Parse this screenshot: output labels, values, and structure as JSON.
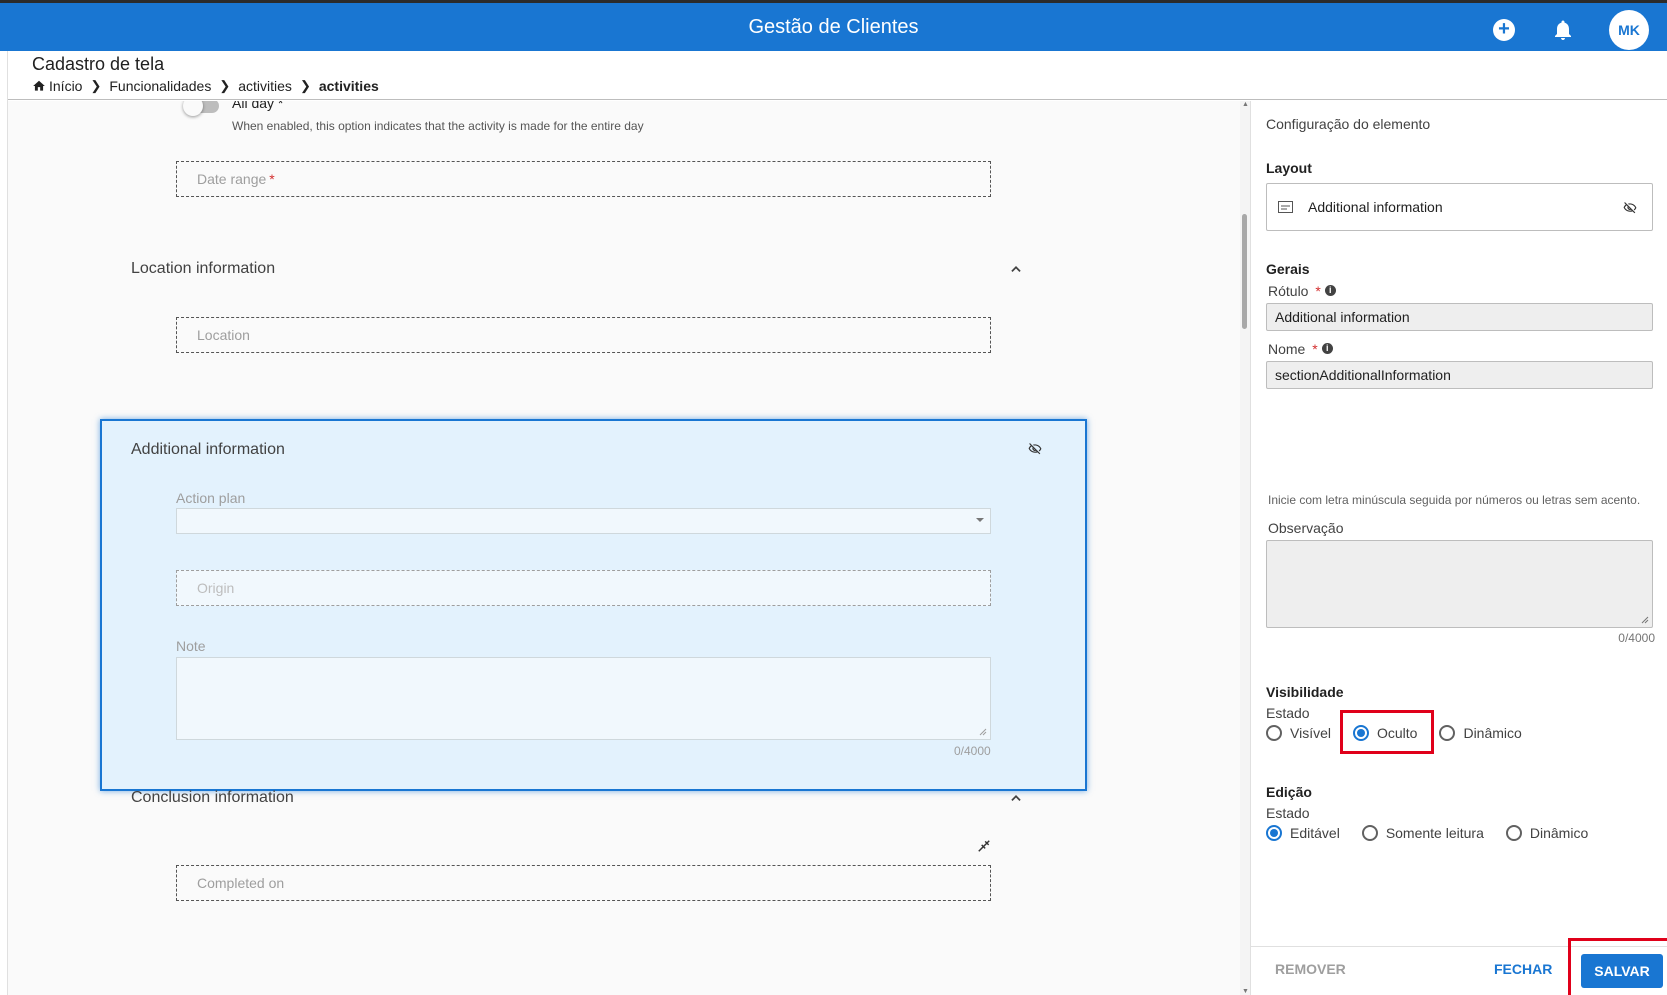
{
  "app": {
    "title": "Gestão de Clientes",
    "avatar_initials": "MK"
  },
  "header": {
    "page_title": "Cadastro de tela",
    "breadcrumb": [
      "Início",
      "Funcionalidades",
      "activities",
      "activities"
    ]
  },
  "form": {
    "all_day": {
      "label": "All day *",
      "hint": "When enabled, this option indicates that the activity is made for the entire day",
      "enabled": false
    },
    "date_range": {
      "placeholder": "Date range",
      "required_mark": "*"
    },
    "location_section": {
      "title": "Location information",
      "location_placeholder": "Location"
    },
    "additional_section": {
      "title": "Additional information",
      "action_plan_label": "Action plan",
      "origin_placeholder": "Origin",
      "note_label": "Note",
      "note_counter": "0/4000"
    },
    "conclusion_section": {
      "title": "Conclusion information",
      "completed_on_placeholder": "Completed on"
    }
  },
  "panel": {
    "title": "Configuração do elemento",
    "layout_heading": "Layout",
    "layout_value": "Additional information",
    "general_heading": "Gerais",
    "label_field": {
      "label": "Rótulo",
      "required_mark": "*",
      "value": "Additional information"
    },
    "name_field": {
      "label": "Nome",
      "required_mark": "*",
      "value": "sectionAdditionalInformation",
      "hint": "Inicie com letra minúscula seguida por números ou letras sem acento."
    },
    "observation": {
      "label": "Observação",
      "counter": "0/4000"
    },
    "visibility": {
      "heading": "Visibilidade",
      "state_label": "Estado",
      "options": [
        "Visível",
        "Oculto",
        "Dinâmico"
      ],
      "selected": "Oculto"
    },
    "editing": {
      "heading": "Edição",
      "state_label": "Estado",
      "options": [
        "Editável",
        "Somente leitura",
        "Dinâmico"
      ],
      "selected": "Editável"
    },
    "footer": {
      "remove": "REMOVER",
      "close": "FECHAR",
      "save": "SALVAR"
    }
  },
  "colors": {
    "primary": "#1976d2",
    "highlight": "#e0001a",
    "selected_bg": "#e3f2fd"
  }
}
